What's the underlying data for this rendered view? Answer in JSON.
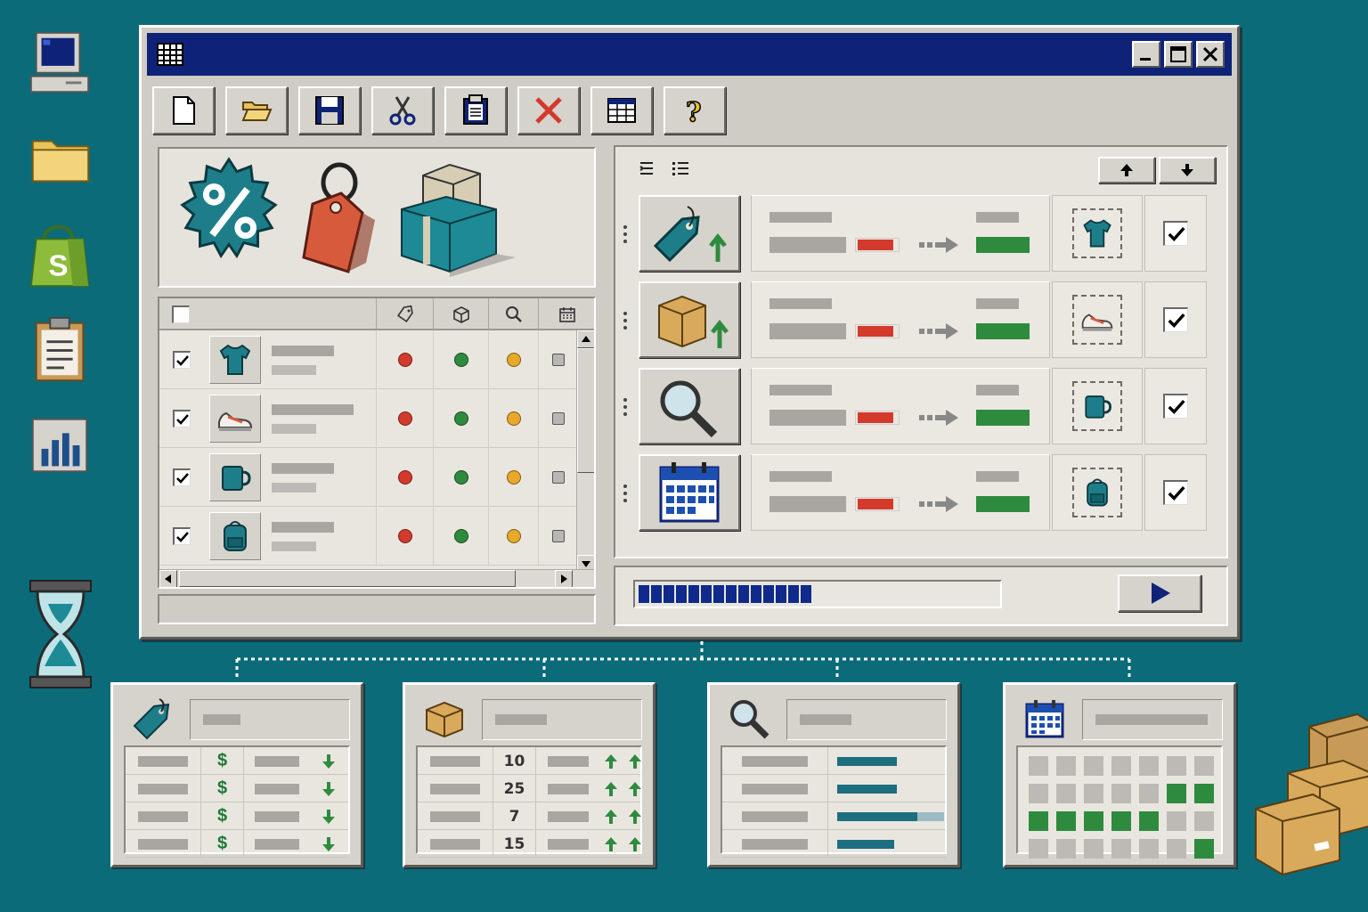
{
  "desktop": {
    "icons": [
      "computer-icon",
      "folder-icon",
      "shopify-bag-icon",
      "clipboard-icon",
      "bar-chart-icon"
    ],
    "hourglass": "hourglass-icon"
  },
  "window": {
    "title_icon": "spreadsheet-icon",
    "controls": [
      "minimize-icon",
      "maximize-icon",
      "close-icon"
    ],
    "toolbar": [
      "new-file-icon",
      "open-folder-icon",
      "save-icon",
      "cut-icon",
      "paste-icon",
      "delete-icon",
      "table-icon",
      "help-icon"
    ]
  },
  "hero": {
    "images": [
      "discount-badge-icon",
      "price-tag-icon",
      "stacked-boxes-icon"
    ]
  },
  "grid": {
    "header_icons": [
      "tag-icon",
      "cube-icon",
      "search-icon",
      "calendar-icon"
    ],
    "rows": [
      {
        "product": "tshirt-icon",
        "checked": true,
        "status": [
          "red",
          "green",
          "yellow",
          "gray"
        ]
      },
      {
        "product": "sneaker-icon",
        "checked": true,
        "status": [
          "red",
          "green",
          "yellow",
          "gray"
        ]
      },
      {
        "product": "mug-icon",
        "checked": true,
        "status": [
          "red",
          "green",
          "yellow",
          "gray"
        ]
      },
      {
        "product": "backpack-icon",
        "checked": true,
        "status": [
          "red",
          "green",
          "yellow",
          "gray"
        ]
      }
    ]
  },
  "rules": {
    "toolbar": [
      "indent-icon",
      "list-icon",
      "arrow-up-icon",
      "arrow-down-icon"
    ],
    "items": [
      {
        "trigger": "price-tag-up-icon",
        "product": "tshirt-icon",
        "checked": true
      },
      {
        "trigger": "box-up-icon",
        "product": "sneaker-icon",
        "checked": true
      },
      {
        "trigger": "magnifier-icon",
        "product": "mug-icon",
        "checked": true
      },
      {
        "trigger": "calendar-icon",
        "product": "backpack-icon",
        "checked": true
      }
    ]
  },
  "progress": {
    "percent": 0.48,
    "run_icon": "play-icon"
  },
  "cards": {
    "pricing": {
      "icon": "tag-icon",
      "rows": [
        "$",
        "$",
        "$",
        "$"
      ]
    },
    "inventory": {
      "icon": "box-icon",
      "quantities": [
        "10",
        "25",
        "7",
        "15"
      ]
    },
    "search": {
      "icon": "magnifier-icon",
      "levels": [
        0.56,
        0.56,
        0.75,
        0.53
      ]
    },
    "schedule": {
      "icon": "calendar-icon",
      "cells": [
        [
          0,
          0,
          0,
          0,
          0,
          0,
          0
        ],
        [
          0,
          0,
          0,
          0,
          0,
          1,
          1
        ],
        [
          1,
          1,
          1,
          1,
          1,
          0,
          0
        ],
        [
          0,
          0,
          0,
          0,
          0,
          0,
          1
        ]
      ]
    }
  },
  "colors": {
    "desktop": "#0b6b78",
    "titlebar": "#0e2377",
    "active": "#2e8b3e",
    "alert": "#d33a2c",
    "accent": "#1d7e8a"
  }
}
